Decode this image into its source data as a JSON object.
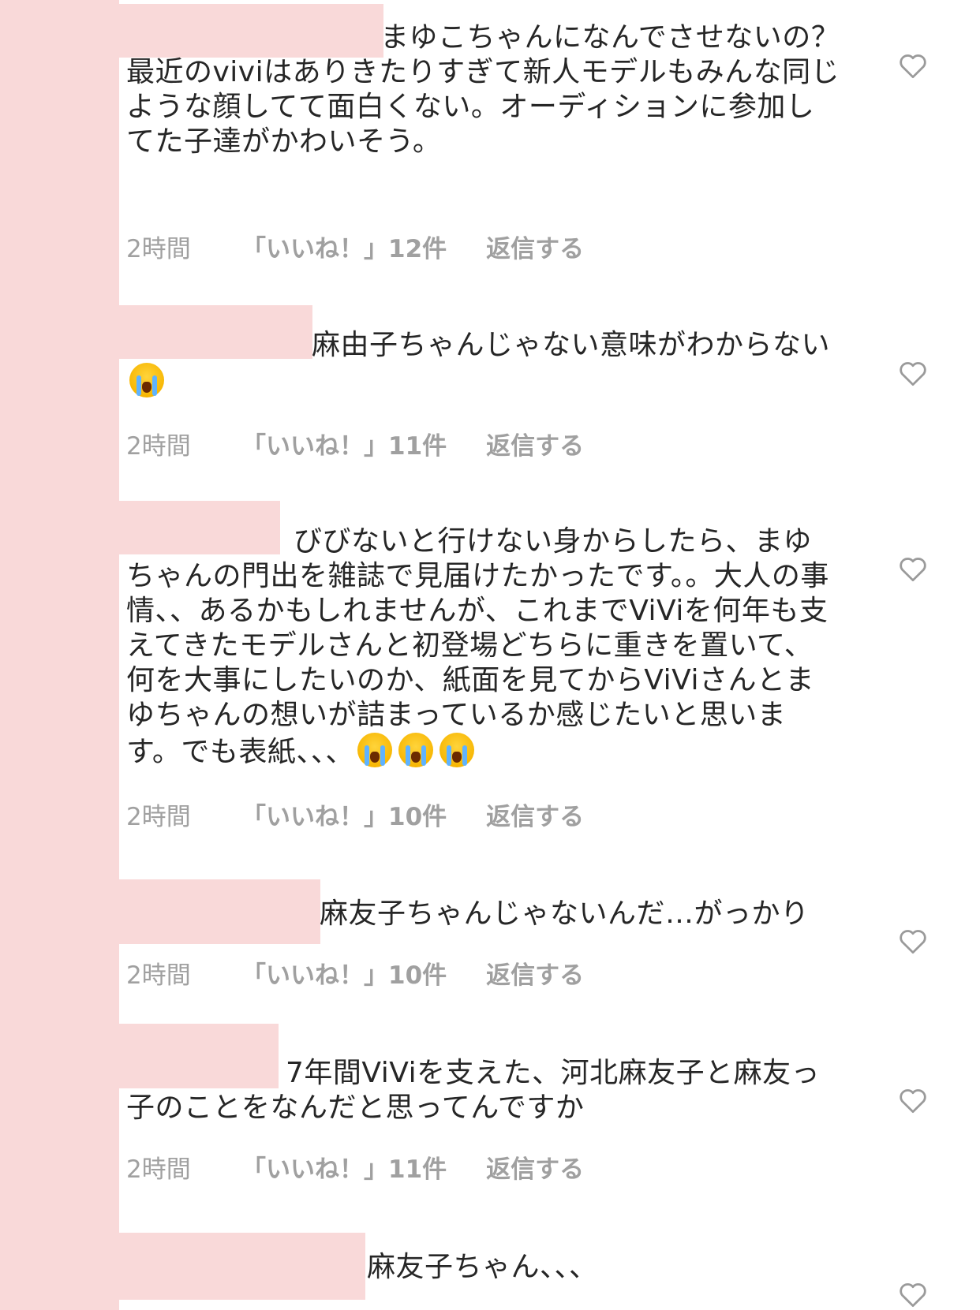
{
  "colors": {
    "mask": "#f9d9d9",
    "text": "#262626",
    "meta": "#a0a0a0"
  },
  "icons": {
    "like": "heart-outline-icon",
    "emoji": "loudly-crying-face"
  },
  "comments": [
    {
      "text": "まゆこちゃんになんでさせないの？\n最近のviviはありきたりすぎて新人モデルもみんな同じような顔してて面白くない。オーディションに参加してた子達がかわいそう。",
      "time": "2時間",
      "likes": "「いいね！」12件",
      "reply": "返信する"
    },
    {
      "text": "麻由子ちゃんじゃない意味がわからない",
      "emoji_count": 1,
      "time": "2時間",
      "likes": "「いいね！」11件",
      "reply": "返信する"
    },
    {
      "text": "びびないと行けない身からしたら、まゆちゃんの門出を雑誌で見届けたかったです。。大人の事情、、あるかもしれませんが、これまでViViを何年も支えてきたモデルさんと初登場どちらに重きを置いて、何を大事にしたいのか、紙面を見てからViViさんとまゆちゃんの想いが詰まっているか感じたいと思います。でも表紙、、、",
      "emoji_count": 3,
      "time": "2時間",
      "likes": "「いいね！」10件",
      "reply": "返信する"
    },
    {
      "text": "麻友子ちゃんじゃないんだ…がっかり",
      "time": "2時間",
      "likes": "「いいね！」10件",
      "reply": "返信する"
    },
    {
      "text": "7年間ViViを支えた、河北麻友子と麻友っ子のことをなんだと思ってんですか",
      "time": "2時間",
      "likes": "「いいね！」11件",
      "reply": "返信する"
    },
    {
      "text": "麻友子ちゃん、、、"
    }
  ]
}
